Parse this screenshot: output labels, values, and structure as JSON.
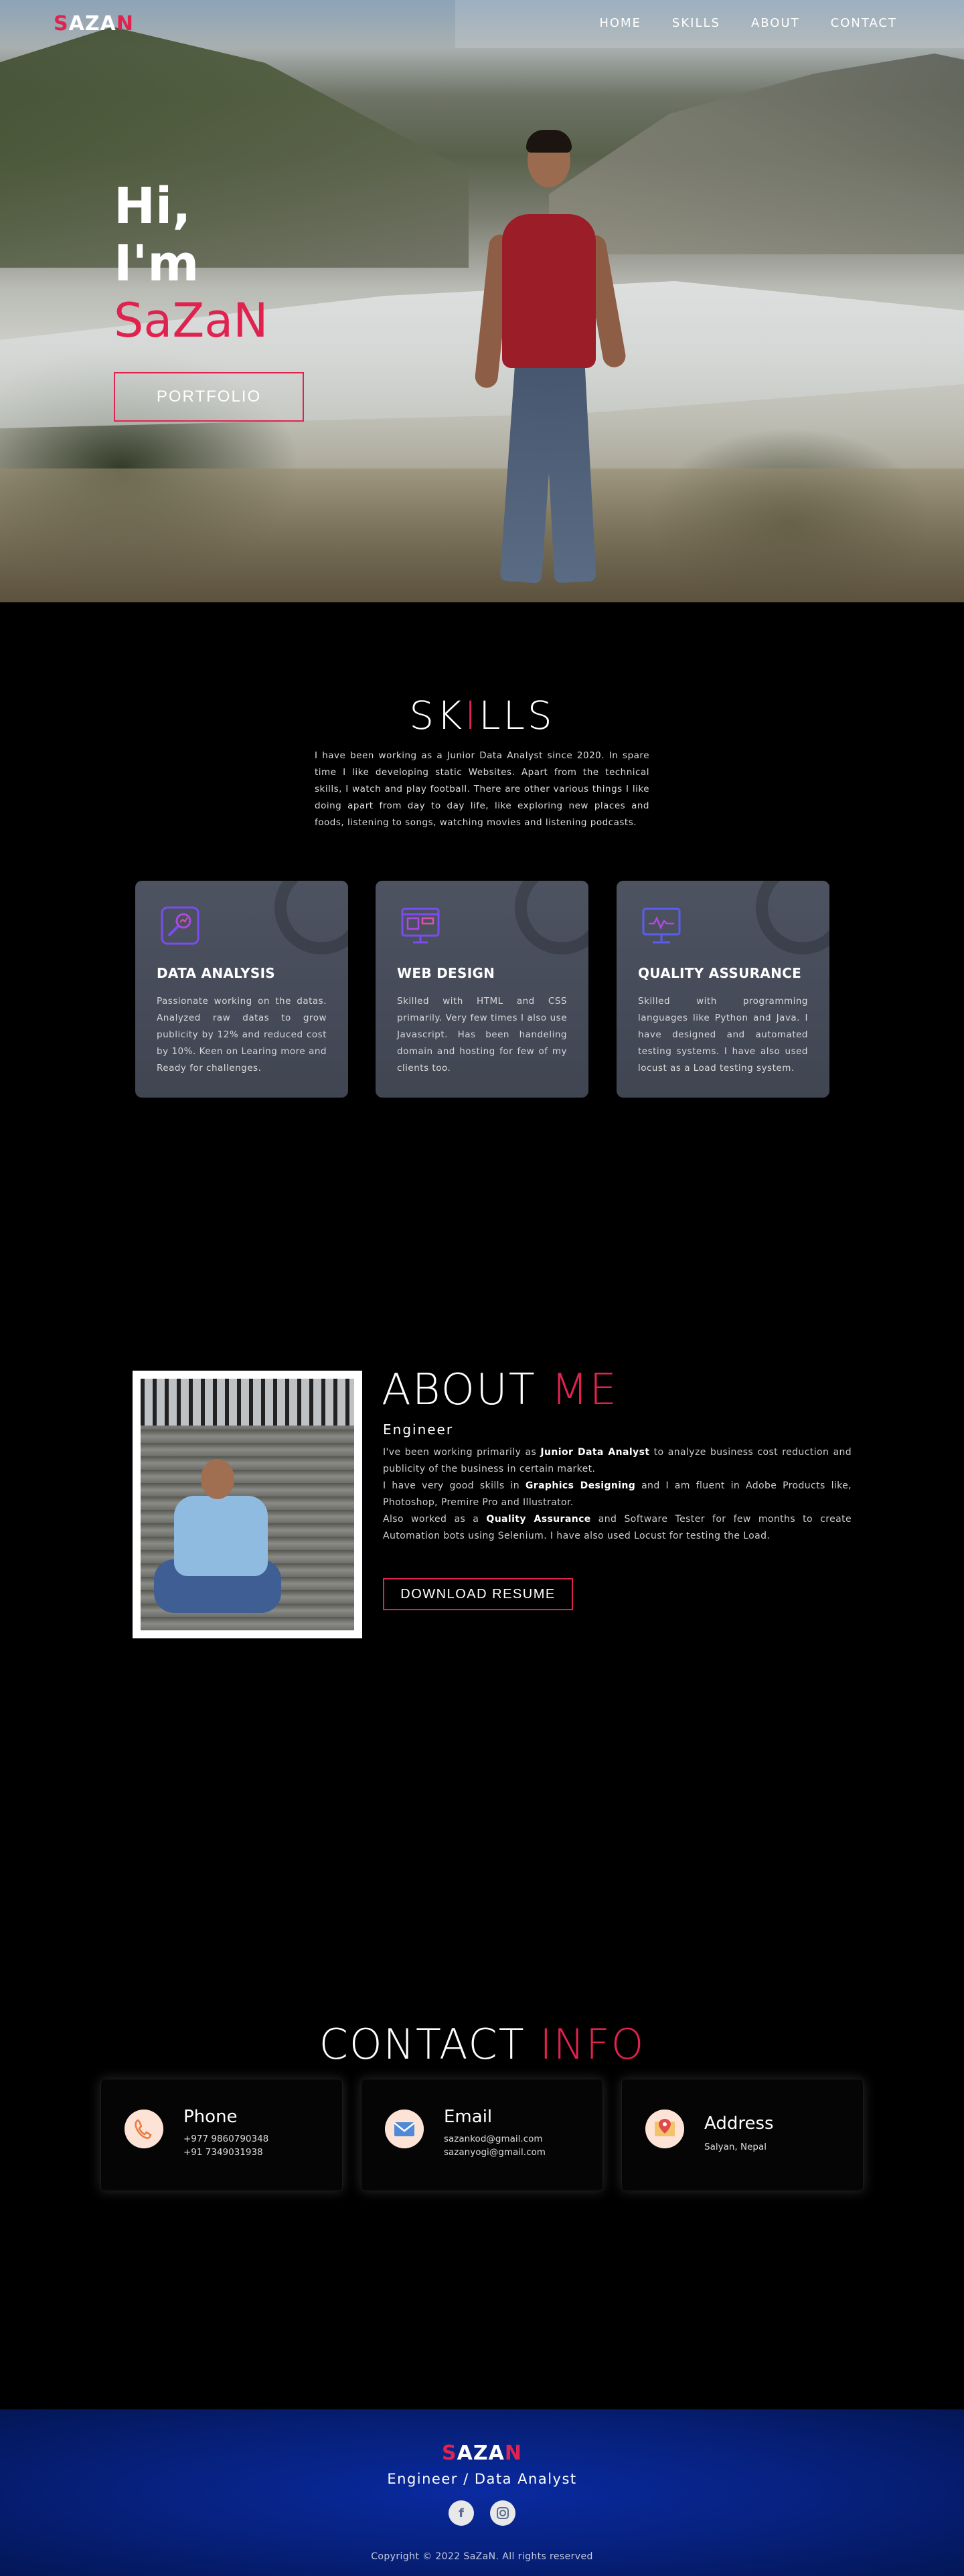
{
  "brand": {
    "logo_a": "S",
    "logo_b": "AZA",
    "logo_c": "N",
    "accent": "#e0234e",
    "footer_blue": "#06207a"
  },
  "nav": {
    "items": [
      "HOME",
      "SKILLS",
      "ABOUT",
      "CONTACT"
    ]
  },
  "hero": {
    "line1": "Hi,",
    "line2": "I'm",
    "name": "SaZaN",
    "button": "PORTFOLIO"
  },
  "skills": {
    "title_a": "SK",
    "title_b": "I",
    "title_c": "LLS",
    "description": "I have been working as a Junior Data Analyst since 2020. In spare time I like developing static Websites. Apart from the technical skills, I watch and play football. There are other various things I like doing apart from day to day life, like exploring new places and foods, listening to songs, watching movies and listening podcasts.",
    "cards": [
      {
        "icon": "data-analysis-icon",
        "title": "DATA ANALYSIS",
        "text": "Passionate working on the datas. Analyzed raw datas to grow publicity by 12% and reduced cost by 10%. Keen on Learing more and Ready for challenges."
      },
      {
        "icon": "web-design-icon",
        "title": "WEB DESIGN",
        "text": "Skilled with HTML and CSS primarily. Very few times I also use Javascript. Has been handeling domain and hosting for few of my clients too."
      },
      {
        "icon": "quality-assurance-icon",
        "title": "QUALITY ASSURANCE",
        "text": "Skilled with programming languages like Python and Java. I have designed and automated testing systems. I have also used locust as a Load testing system."
      }
    ]
  },
  "about": {
    "title_a": "ABOUT ",
    "title_b": "ME",
    "subtitle": "Engineer",
    "p1_a": "I've been working primarily as ",
    "p1_b": "Junior Data Analyst",
    "p1_c": " to analyze business cost reduction and publicity of the business in certain market.",
    "p2_a": "I have very good skills in ",
    "p2_b": "Graphics Designing",
    "p2_c": " and I am fluent in Adobe Products like, Photoshop, Premire Pro and Illustrator.",
    "p3_a": "Also worked as a ",
    "p3_b": "Quality Assurance",
    "p3_c": " and Software Tester for few months to create Automation bots using Selenium. I have also used Locust for testing the Load.",
    "button": "DOWNLOAD RESUME"
  },
  "contact": {
    "title_a": "CONTACT ",
    "title_b": "INFO",
    "phone": {
      "label": "Phone",
      "line1": "+977 9860790348",
      "line2": "+91 7349031938",
      "icon": "phone-icon"
    },
    "email": {
      "label": "Email",
      "line1": "sazankod@gmail.com",
      "line2": "sazanyogi@gmail.com",
      "icon": "mail-icon"
    },
    "address": {
      "label": "Address",
      "line1": "Salyan, Nepal",
      "icon": "map-icon"
    }
  },
  "footer": {
    "logo_a": "S",
    "logo_b": "AZA",
    "logo_c": "N",
    "tagline": "Engineer / Data Analyst",
    "socials": [
      "facebook-icon",
      "instagram-icon"
    ],
    "copyright": "Copyright © 2022 SaZaN. All rights reserved"
  }
}
